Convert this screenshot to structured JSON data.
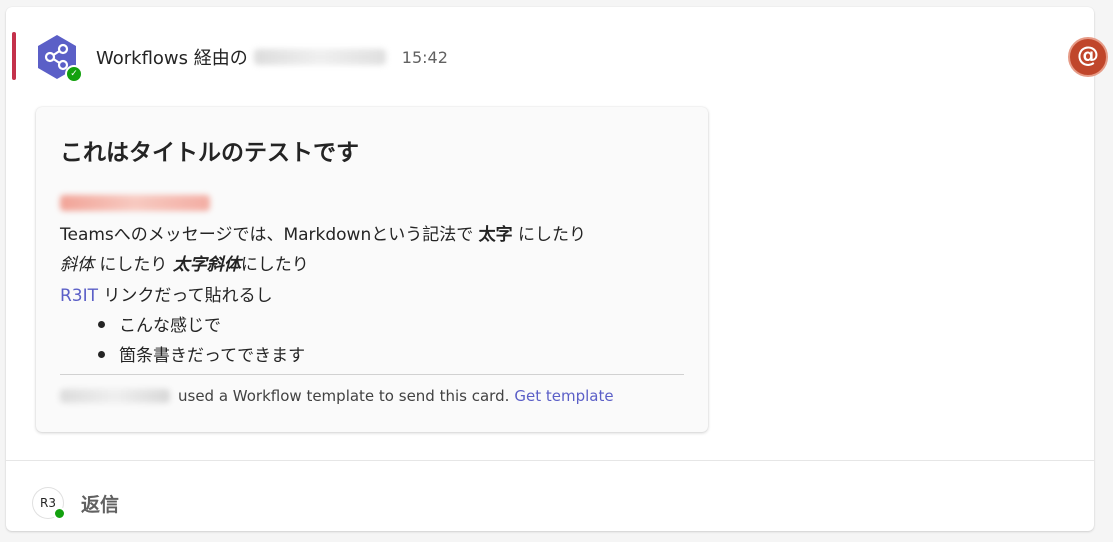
{
  "message": {
    "sender_prefix": "Workflows 経由の",
    "timestamp": "15:42",
    "mention_symbol": "@"
  },
  "card": {
    "title": "これはタイトルのテストです",
    "line1": {
      "pre": "Teamsへのメッセージでは、Markdownという記法で ",
      "bold": "太字",
      "post": " にしたり"
    },
    "line2": {
      "italic": "斜体",
      "mid": " にしたり ",
      "bold_italic": "太字斜体",
      "post": "にしたり"
    },
    "line3": {
      "link": "R3IT",
      "post": " リンクだって貼れるし"
    },
    "bullets": [
      "こんな感じで",
      "箇条書きだってできます"
    ],
    "footer": {
      "text": "used a Workflow template to send this card.",
      "link": "Get template"
    }
  },
  "reply": {
    "avatar_initials": "R3",
    "label": "返信"
  },
  "colors": {
    "accent_bar": "#c4314b",
    "app_icon": "#5b5fc7",
    "link": "#5b5fc7",
    "mention_badge": "#c0462b",
    "presence": "#13a10e"
  }
}
